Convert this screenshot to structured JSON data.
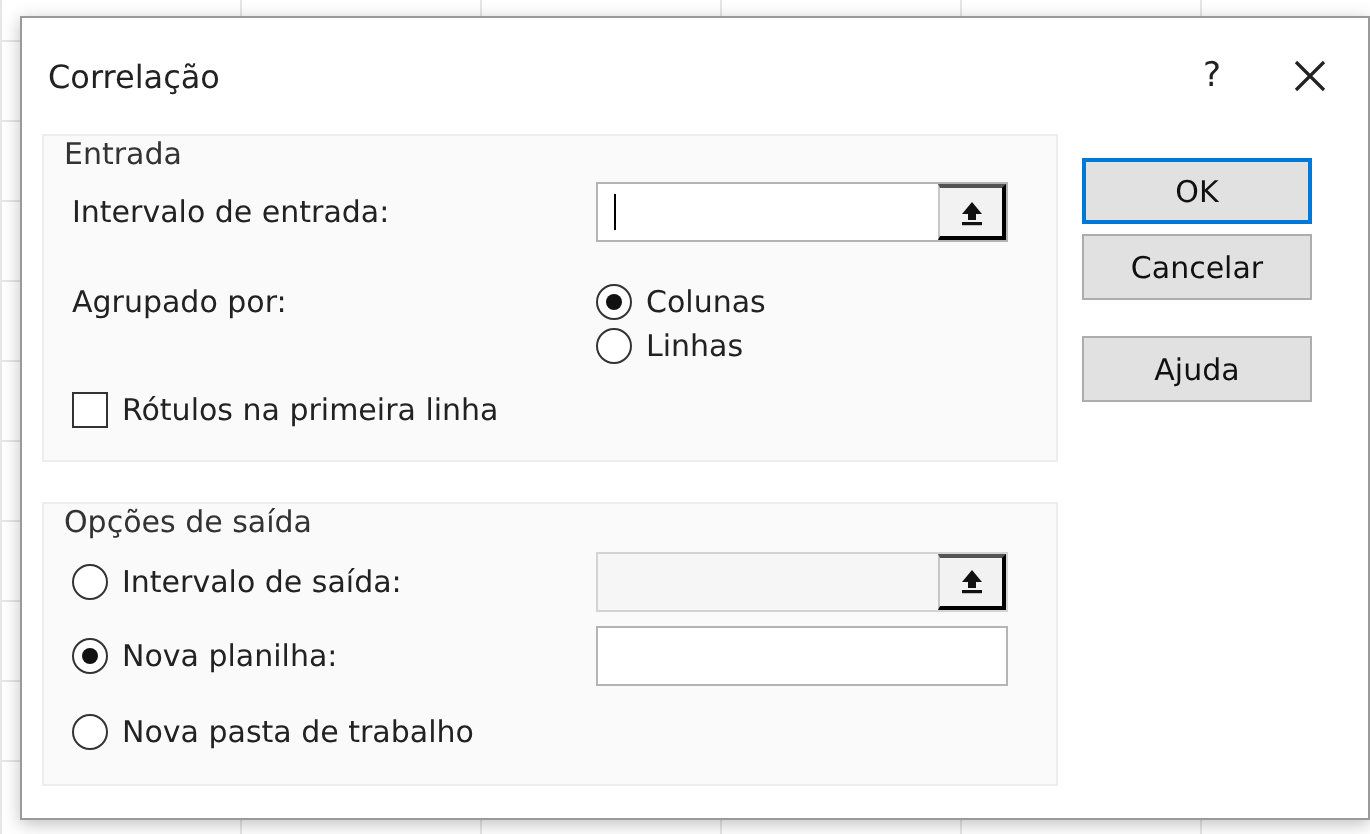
{
  "window": {
    "title": "Correlação",
    "help_button": "?"
  },
  "input_group": {
    "title": "Entrada",
    "range": {
      "label": "Intervalo de entrada:",
      "focused": true
    },
    "grouped_by": {
      "label": "Agrupado por:",
      "options": [
        {
          "label": "Colunas",
          "selected": true
        },
        {
          "label": "Linhas",
          "selected": false
        }
      ]
    },
    "labels_in_first_row": {
      "label": "Rótulos na primeira linha",
      "checked": false
    }
  },
  "output_group": {
    "title": "Opções de saída",
    "options": [
      {
        "kind": "range",
        "label": "Intervalo de saída:",
        "selected": false,
        "field_disabled": true
      },
      {
        "kind": "sheet",
        "label": "Nova planilha:",
        "selected": true
      },
      {
        "kind": "workbook",
        "label": "Nova pasta de trabalho",
        "selected": false
      }
    ]
  },
  "buttons": [
    {
      "label": "OK",
      "default": true
    },
    {
      "label": "Cancelar",
      "default": false
    },
    {
      "label": "Ajuda",
      "default": false
    }
  ]
}
